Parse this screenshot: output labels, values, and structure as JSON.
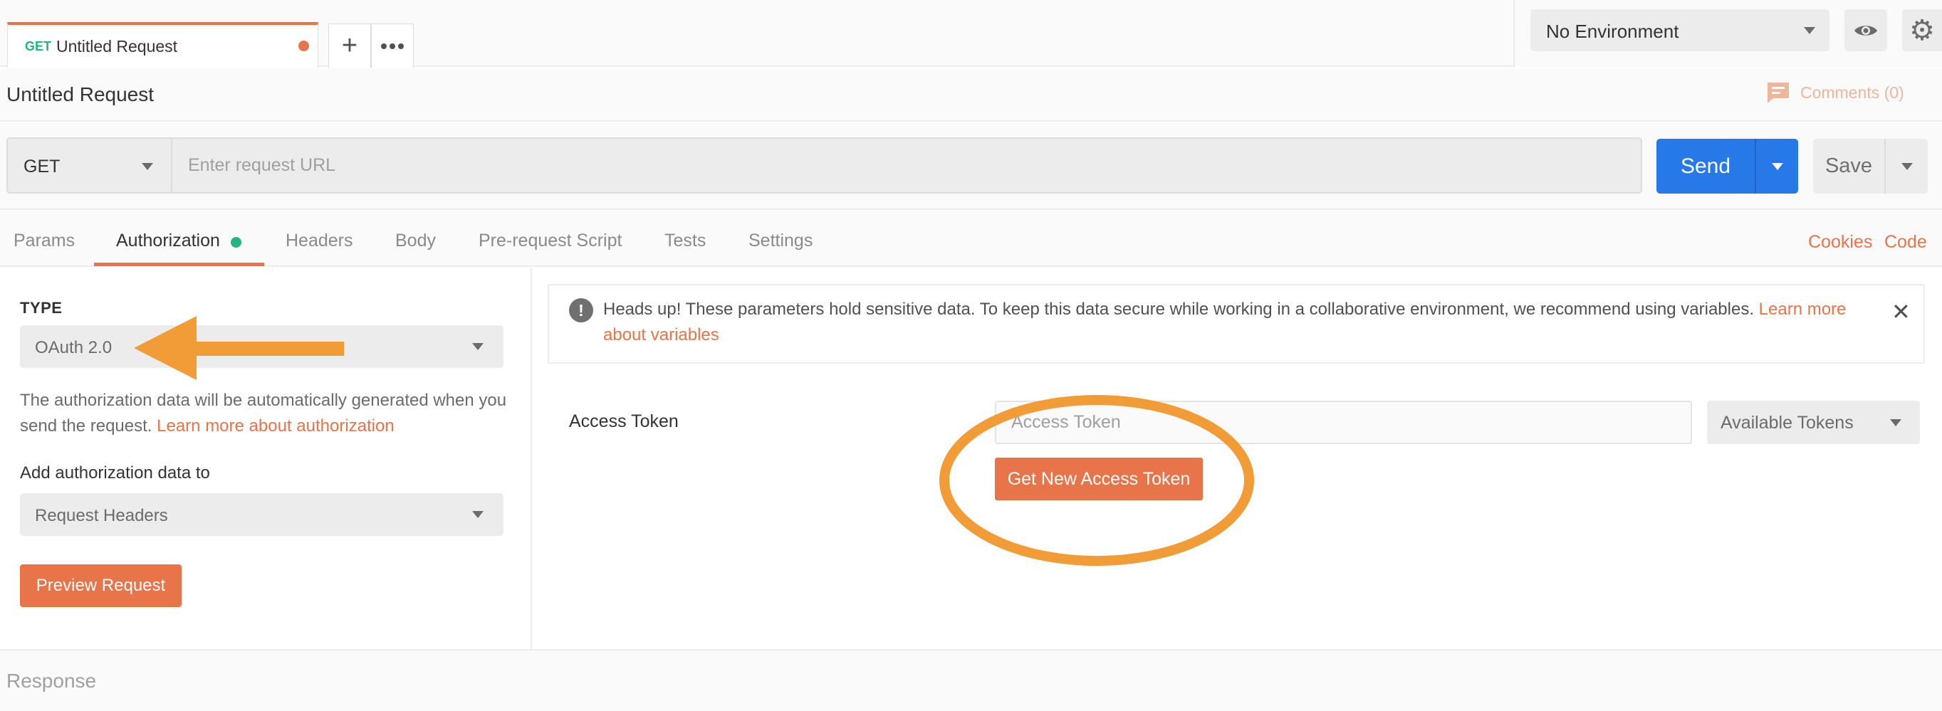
{
  "top_tabs": {
    "request_tab": {
      "method": "GET",
      "name": "Untitled Request"
    },
    "add_tab_icon": "plus-icon",
    "more_icon": "ellipsis-icon"
  },
  "environment": {
    "selected": "No Environment",
    "eye_icon": "eye-icon",
    "settings_icon": "gear-icon"
  },
  "request": {
    "title": "Untitled Request",
    "comments_label": "Comments (0)",
    "method": "GET",
    "url_placeholder": "Enter request URL",
    "send_label": "Send",
    "save_label": "Save"
  },
  "request_tabs": [
    {
      "label": "Params"
    },
    {
      "label": "Authorization"
    },
    {
      "label": "Headers"
    },
    {
      "label": "Body"
    },
    {
      "label": "Pre-request Script"
    },
    {
      "label": "Tests"
    },
    {
      "label": "Settings"
    }
  ],
  "request_links": {
    "cookies": "Cookies",
    "code": "Code"
  },
  "auth": {
    "type_label": "TYPE",
    "type_value": "OAuth 2.0",
    "desc_text": "The authorization data will be automatically generated when you send the request.",
    "desc_link": "Learn more about authorization",
    "add_to_label": "Add authorization data to",
    "add_to_value": "Request Headers",
    "preview_label": "Preview Request"
  },
  "alert": {
    "text": "Heads up! These parameters hold sensitive data. To keep this data secure while working in a collaborative environment, we recommend using variables.",
    "link": "Learn more about variables",
    "icon": "exclamation-icon",
    "close_icon": "close-icon"
  },
  "token": {
    "label": "Access Token",
    "placeholder": "Access Token",
    "available_label": "Available Tokens",
    "get_new_label": "Get New Access Token"
  },
  "response": {
    "label": "Response"
  },
  "annotations": {
    "color": "#f29c38",
    "arrow": "arrow-left",
    "circle": "ellipse-highlight"
  },
  "colors": {
    "accent": "#e8744a",
    "send_blue": "#2679e6",
    "success_green": "#26b47f"
  }
}
